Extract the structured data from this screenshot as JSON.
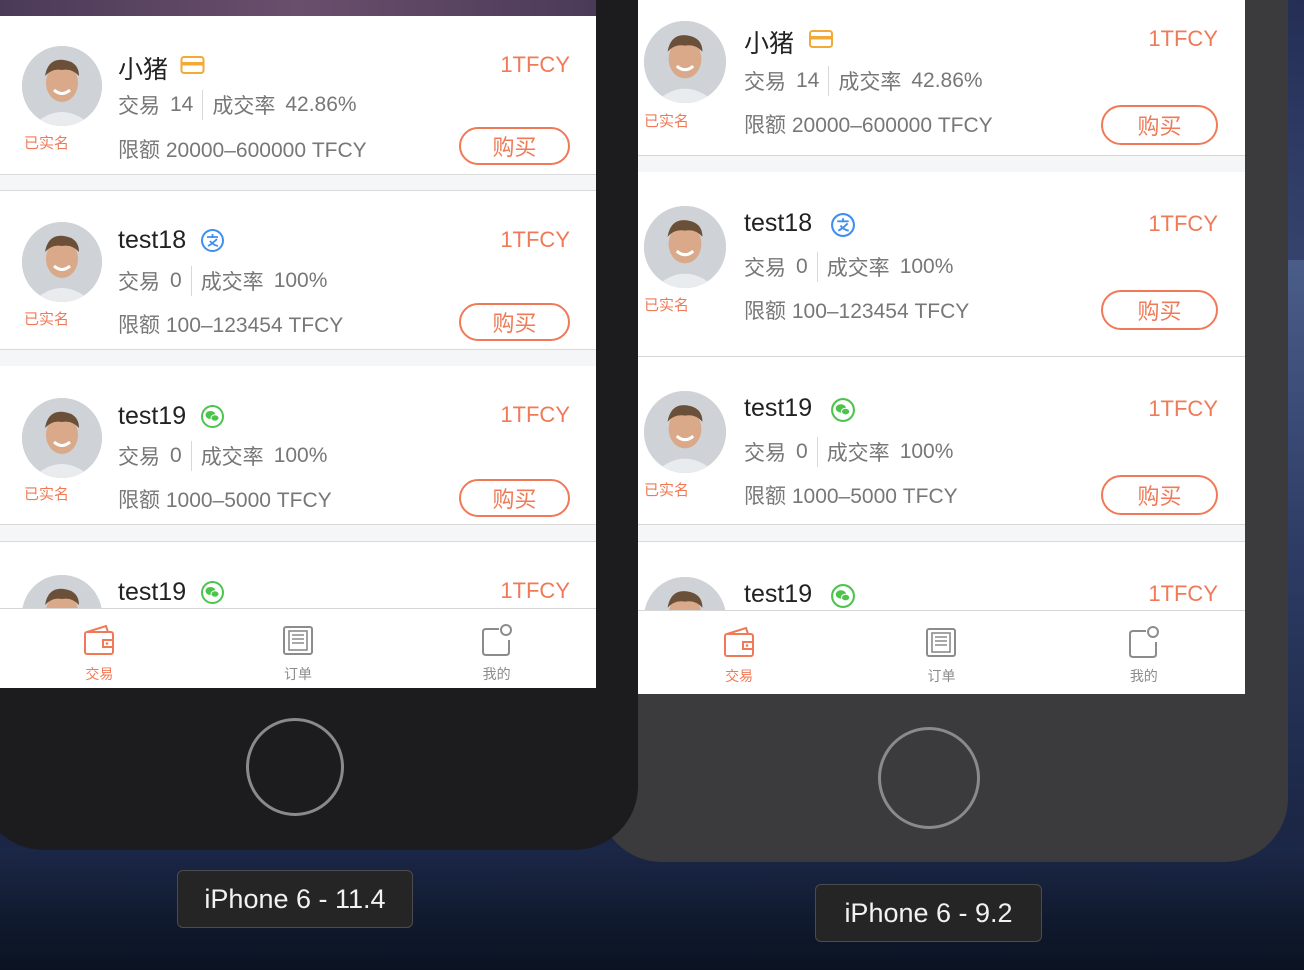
{
  "colors": {
    "accent": "#f07a57",
    "pay_card": "#f3a935",
    "pay_alipay": "#3f8ef0",
    "pay_wechat": "#4cc44c",
    "inactive": "#8c8c8c"
  },
  "simulators": [
    {
      "label": "iPhone 6 - 11.4",
      "listings": [
        {
          "name": "小猪",
          "payment_icon": "card-icon",
          "verified": "已实名",
          "price": "1TFCY",
          "trades_label": "交易",
          "trades": "14",
          "rate_label": "成交率",
          "rate": "42.86%",
          "limit_label": "限额",
          "limit": "20000–600000 TFCY",
          "buy_label": "购买"
        },
        {
          "name": "test18",
          "payment_icon": "alipay-icon",
          "verified": "已实名",
          "price": "1TFCY",
          "trades_label": "交易",
          "trades": "0",
          "rate_label": "成交率",
          "rate": "100%",
          "limit_label": "限额",
          "limit": "100–123454 TFCY",
          "buy_label": "购买"
        },
        {
          "name": "test19",
          "payment_icon": "wechat-icon",
          "verified": "已实名",
          "price": "1TFCY",
          "trades_label": "交易",
          "trades": "0",
          "rate_label": "成交率",
          "rate": "100%",
          "limit_label": "限额",
          "limit": "1000–5000 TFCY",
          "buy_label": "购买"
        },
        {
          "name": "test19",
          "payment_icon": "wechat-icon",
          "price": "1TFCY"
        }
      ],
      "tabs": [
        {
          "label": "交易",
          "icon": "wallet-icon",
          "active": true
        },
        {
          "label": "订单",
          "icon": "orders-icon",
          "active": false
        },
        {
          "label": "我的",
          "icon": "profile-icon",
          "active": false
        }
      ]
    },
    {
      "label": "iPhone 6 - 9.2",
      "listings": [
        {
          "name": "小猪",
          "payment_icon": "card-icon",
          "verified": "已实名",
          "price": "1TFCY",
          "trades_label": "交易",
          "trades": "14",
          "rate_label": "成交率",
          "rate": "42.86%",
          "limit_label": "限额",
          "limit": "20000–600000 TFCY",
          "buy_label": "购买"
        },
        {
          "name": "test18",
          "payment_icon": "alipay-icon",
          "verified": "已实名",
          "price": "1TFCY",
          "trades_label": "交易",
          "trades": "0",
          "rate_label": "成交率",
          "rate": "100%",
          "limit_label": "限额",
          "limit": "100–123454 TFCY",
          "buy_label": "购买"
        },
        {
          "name": "test19",
          "payment_icon": "wechat-icon",
          "verified": "已实名",
          "price": "1TFCY",
          "trades_label": "交易",
          "trades": "0",
          "rate_label": "成交率",
          "rate": "100%",
          "limit_label": "限额",
          "limit": "1000–5000 TFCY",
          "buy_label": "购买"
        },
        {
          "name": "test19",
          "payment_icon": "wechat-icon",
          "price": "1TFCY"
        }
      ],
      "tabs": [
        {
          "label": "交易",
          "icon": "wallet-icon",
          "active": true
        },
        {
          "label": "订单",
          "icon": "orders-icon",
          "active": false
        },
        {
          "label": "我的",
          "icon": "profile-icon",
          "active": false
        }
      ]
    }
  ]
}
